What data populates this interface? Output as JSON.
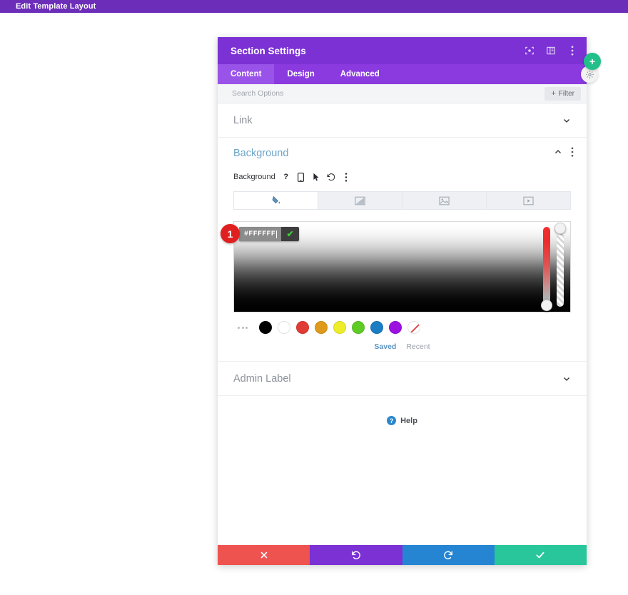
{
  "topbar": {
    "title": "Edit Template Layout"
  },
  "modal": {
    "title": "Section Settings",
    "header_icons": [
      {
        "name": "focus-icon"
      },
      {
        "name": "layout-panel-icon"
      },
      {
        "name": "more-vertical-icon"
      }
    ],
    "tabs": [
      {
        "label": "Content",
        "active": true
      },
      {
        "label": "Design",
        "active": false
      },
      {
        "label": "Advanced",
        "active": false
      }
    ],
    "search": {
      "placeholder": "Search Options",
      "value": ""
    },
    "filter_button": {
      "plus": "+",
      "label": "Filter"
    }
  },
  "sections": {
    "link": {
      "label": "Link",
      "expanded": false
    },
    "background": {
      "label": "Background",
      "expanded": true,
      "control_label": "Background",
      "control_icons": [
        {
          "name": "help-icon",
          "glyph": "?"
        },
        {
          "name": "responsive-mobile-icon"
        },
        {
          "name": "hover-cursor-icon"
        },
        {
          "name": "reset-undo-icon"
        },
        {
          "name": "more-vertical-icon"
        }
      ],
      "type_tabs": [
        {
          "name": "background-color-tab",
          "active": true
        },
        {
          "name": "background-gradient-tab",
          "active": false
        },
        {
          "name": "background-image-tab",
          "active": false
        },
        {
          "name": "background-video-tab",
          "active": false
        }
      ],
      "color_picker": {
        "hex_value": "#FFFFFF",
        "confirm_glyph": "✔",
        "annotation_badge": "1",
        "swatches": [
          {
            "name": "swatch-black",
            "color": "#000000"
          },
          {
            "name": "swatch-white",
            "color": "#ffffff"
          },
          {
            "name": "swatch-red",
            "color": "#e03b35"
          },
          {
            "name": "swatch-orange",
            "color": "#e09a1b"
          },
          {
            "name": "swatch-yellow",
            "color": "#eded2a"
          },
          {
            "name": "swatch-green",
            "color": "#5fcb25"
          },
          {
            "name": "swatch-blue",
            "color": "#1b7ec4"
          },
          {
            "name": "swatch-purple",
            "color": "#9b11e0"
          }
        ],
        "transparent_swatch": {
          "name": "swatch-transparent"
        },
        "palette_tabs": [
          {
            "label": "Saved",
            "active": true
          },
          {
            "label": "Recent",
            "active": false
          }
        ]
      }
    },
    "admin_label": {
      "label": "Admin Label",
      "expanded": false
    }
  },
  "help": {
    "glyph": "?",
    "label": "Help"
  },
  "footer_buttons": [
    {
      "name": "cancel-button",
      "glyph": "✖"
    },
    {
      "name": "undo-button",
      "glyph": "↺"
    },
    {
      "name": "redo-button",
      "glyph": "↻"
    },
    {
      "name": "save-button",
      "glyph": "✔"
    }
  ],
  "floating": {
    "add_button": {
      "name": "add-section-button",
      "glyph": "+"
    },
    "settings_button": {
      "name": "settings-gear-button"
    }
  },
  "colors": {
    "brand_purple": "#7b31d4",
    "admin_purple": "#6c2eb9",
    "accent_blue": "#6ba4c8",
    "danger_red": "#ef5350",
    "success_green": "#28c69a",
    "badge_red": "#e02020"
  }
}
